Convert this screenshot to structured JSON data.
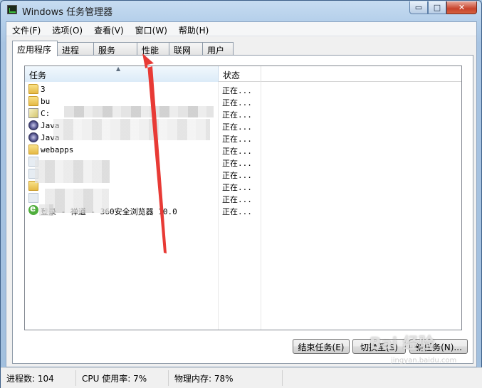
{
  "window": {
    "title": "Windows 任务管理器",
    "controls": {
      "minimize": "▭",
      "maximize": "□",
      "close": "✕"
    }
  },
  "menu": [
    "文件(F)",
    "选项(O)",
    "查看(V)",
    "窗口(W)",
    "帮助(H)"
  ],
  "tabs": [
    "应用程序",
    "进程",
    "服务",
    "性能",
    "联网",
    "用户"
  ],
  "active_tab": "应用程序",
  "table": {
    "columns": [
      "任务",
      "状态"
    ],
    "rows": [
      {
        "icon": "folder-icon",
        "name": "3",
        "status": "正在..."
      },
      {
        "icon": "folder-icon",
        "name": "bu",
        "status": "正在..."
      },
      {
        "icon": "edit-icon",
        "name": "C:",
        "status": "正在..."
      },
      {
        "icon": "java-icon",
        "name": "Java",
        "status": "正在..."
      },
      {
        "icon": "java-icon",
        "name": "Java",
        "status": "正在..."
      },
      {
        "icon": "folder-icon",
        "name": "webapps",
        "status": "正在..."
      },
      {
        "icon": "generic-icon",
        "name": "",
        "status": "正在..."
      },
      {
        "icon": "generic-icon",
        "name": "",
        "status": "正在..."
      },
      {
        "icon": "folder-icon",
        "name": "",
        "status": "正在..."
      },
      {
        "icon": "generic-icon",
        "name": "",
        "status": "正在..."
      },
      {
        "icon": "ie-icon",
        "name": "登录 - 禅道 - 360安全浏览器 10.0",
        "status": "正在..."
      }
    ]
  },
  "buttons": {
    "end_task": "结束任务(E)",
    "switch_to": "切换至(S)",
    "new_task": "新任务(N)..."
  },
  "statusbar": {
    "processes": "进程数: 104",
    "cpu": "CPU 使用率: 7%",
    "memory": "物理内存: 78%"
  },
  "annotation": {
    "color": "#e83a35"
  },
  "watermark": {
    "text": "Bai 经验",
    "sub": "jingyan.baidu.com"
  }
}
